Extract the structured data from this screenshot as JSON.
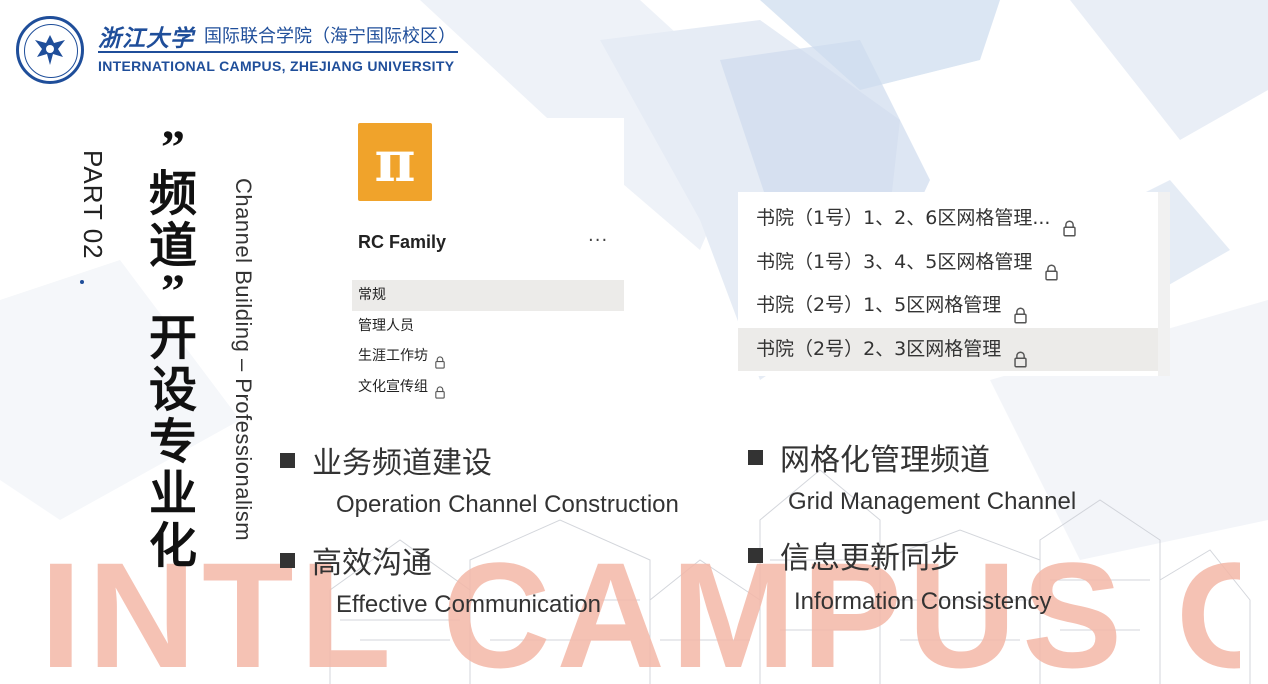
{
  "header": {
    "university_cn": "浙江大学",
    "campus_cn": "国际联合学院（海宁国际校区）",
    "campus_en": "INTERNATIONAL CAMPUS, ZHEJIANG UNIVERSITY"
  },
  "section": {
    "part_label": "PART 02",
    "title_cn_chars": [
      "”",
      "频",
      "道",
      "”",
      "开",
      "设",
      "专",
      "业",
      "化"
    ],
    "title_en": "Channel Building – Professionalism"
  },
  "rc_panel": {
    "icon_glyph": "π",
    "title": "RC Family",
    "more": "···",
    "channels": [
      {
        "label": "常规",
        "locked": false,
        "selected": true
      },
      {
        "label": "管理人员",
        "locked": false,
        "selected": false
      },
      {
        "label": "生涯工作坊",
        "locked": true,
        "selected": false
      },
      {
        "label": "文化宣传组",
        "locked": true,
        "selected": false
      }
    ]
  },
  "grid_panel": {
    "channels": [
      {
        "label": "书院（1号）1、2、6区网格管理...",
        "locked": true,
        "selected": false
      },
      {
        "label": "书院（1号）3、4、5区网格管理",
        "locked": true,
        "selected": false
      },
      {
        "label": "书院（2号）1、5区网格管理",
        "locked": true,
        "selected": false
      },
      {
        "label": "书院（2号）2、3区网格管理",
        "locked": true,
        "selected": true
      }
    ]
  },
  "bullets": [
    {
      "cn": "业务频道建设",
      "en": "Operation Channel Construction"
    },
    {
      "cn": "高效沟通",
      "en": "Effective Communication"
    },
    {
      "cn": "网格化管理频道",
      "en": "Grid Management Channel"
    },
    {
      "cn": "信息更新同步",
      "en": "Information Consistency"
    }
  ],
  "colors": {
    "brand_blue": "#1f4e9a",
    "icon_orange": "#f0a32b",
    "watermark": "#f4b8a8",
    "selected_row": "#ecebe9"
  }
}
